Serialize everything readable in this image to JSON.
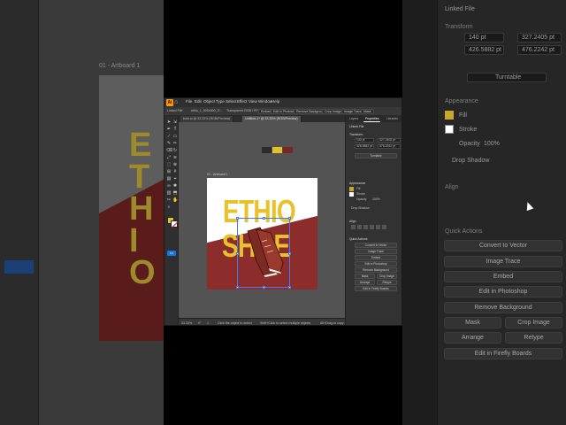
{
  "colors": {
    "yellow": "#e8c22b",
    "maroon": "#8c2d2c",
    "swatch1": "#2b2b2b",
    "swatch2": "#e3c12a",
    "swatch3": "#7a2626",
    "accent_blue": "#1473e6",
    "orange": "#ff9a00"
  },
  "bg_left": {
    "artboard_label": "01 - Artboard 1",
    "art_letters": [
      "E",
      "T",
      "H",
      "I",
      "O"
    ]
  },
  "app": {
    "logo": "Ai",
    "menu": [
      "File",
      "Edit",
      "Object",
      "Type",
      "Select",
      "Effect",
      "View",
      "Window",
      "Help"
    ],
    "control_bar": {
      "object_label": "Linked File",
      "doc_label": "ethio_1_500x500_IT...",
      "mode_label": "Transparent RGB / PPI 200",
      "buttons": [
        "Embed",
        "Edit in Photoshop",
        "Remove Background",
        "Crop Image",
        "Image Trace",
        "Mask"
      ]
    },
    "tabs": [
      "bold.ai @ 33.33% (RGB/Preview)",
      "Untitled-1* @ 33.33% (RGB/Preview)"
    ],
    "tool_icons": [
      "selection-icon",
      "direct-selection-icon",
      "pen-icon",
      "type-icon",
      "line-icon",
      "rectangle-icon",
      "brush-icon",
      "pencil-icon",
      "eraser-icon",
      "rotate-icon",
      "scale-icon",
      "width-icon",
      "free-transform-icon",
      "shape-builder-icon",
      "perspective-icon",
      "mesh-icon",
      "gradient-icon",
      "eyedropper-icon",
      "blend-icon",
      "symbol-icon",
      "graph-icon",
      "artboard-icon",
      "slice-icon",
      "hand-icon",
      "zoom-icon"
    ],
    "tool_glyphs": [
      "➤",
      "⇲",
      "✒",
      "T",
      "∕",
      "▭",
      "✎",
      "✏",
      "⌫",
      "↻",
      "⤢",
      "≋",
      "⬚",
      "⊕",
      "⊞",
      "#",
      "▤",
      "⌖",
      "∞",
      "✱",
      "▥",
      "⬒",
      "✂",
      "✋",
      "⌕"
    ],
    "artboard_label": "01 - Artboard 1",
    "artwork": {
      "line1": "ETHIO",
      "line2": "SHOE"
    },
    "status": {
      "zoom": "33.33%",
      "rotate": "0°",
      "artboard": "1",
      "hint": "Click the object to select",
      "hint2": "Shift+Click to select multiple objects",
      "hint3": "Alt+Drag to copy or duplicate"
    },
    "panel": {
      "tabs": [
        "Layers",
        "Properties",
        "Libraries"
      ],
      "section_linked": "Linked File",
      "section_transform": "Transform",
      "x": "140 pt",
      "y": "327.2405 pt",
      "w": "426.5882 pt",
      "h": "476.2242 pt",
      "turnable": "Turntable",
      "section_appearance": "Appearance",
      "fill": "Fill",
      "stroke": "Stroke",
      "opacity": "Opacity",
      "opacity_value": "100%",
      "drop_shadow": "Drop Shadow",
      "section_align": "Align",
      "section_quick": "Quick Actions",
      "actions": [
        "Convert to Vector",
        "Image Trace",
        "Embed",
        "Edit in Photoshop",
        "Remove Background"
      ],
      "actions_pair1": [
        "Mask",
        "Crop Image"
      ],
      "actions_pair2": [
        "Arrange",
        "Retype"
      ],
      "action_last": "Edit in Firefly Boards"
    }
  }
}
